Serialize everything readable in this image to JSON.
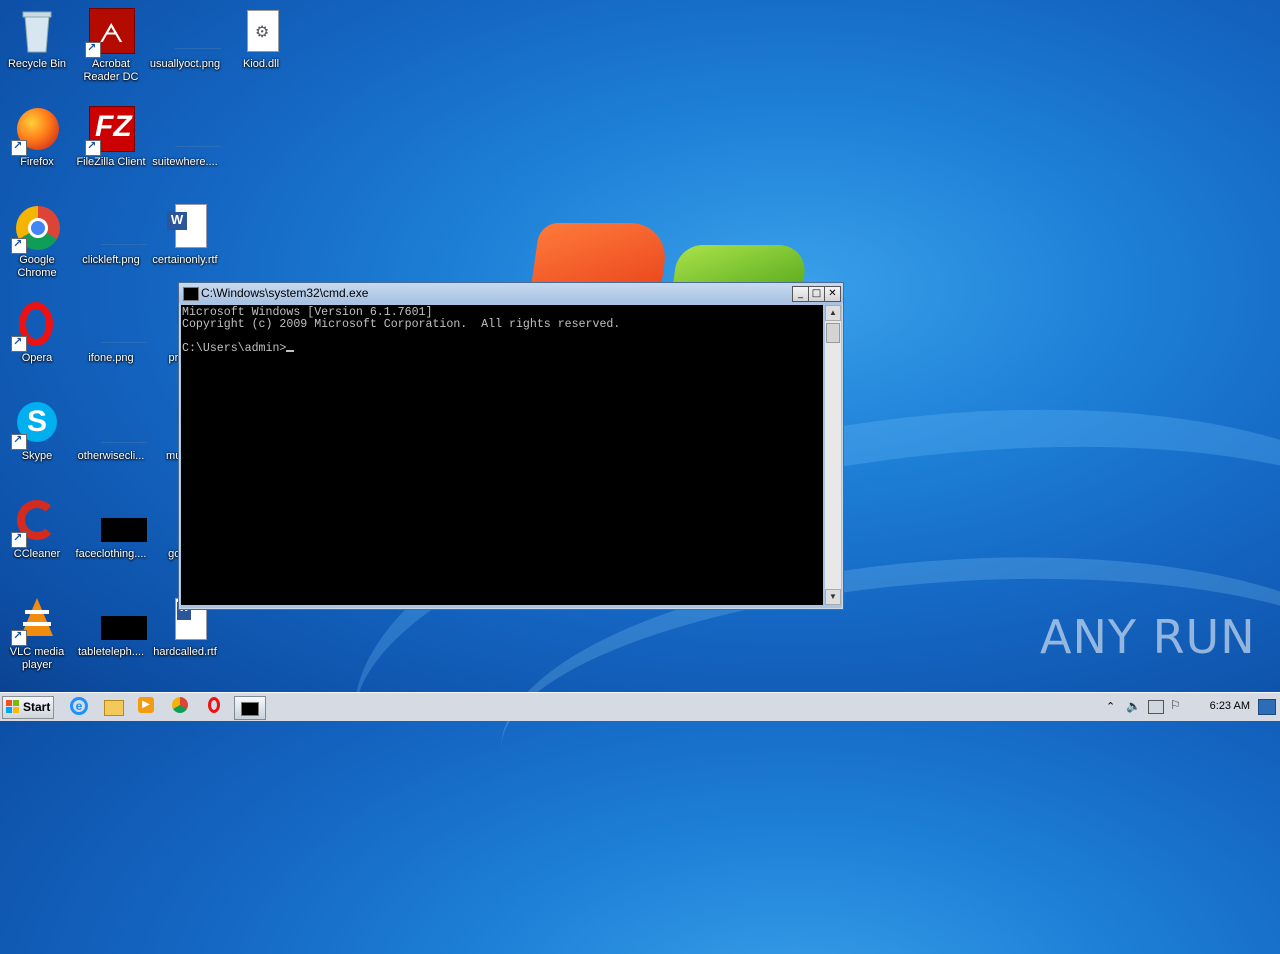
{
  "desktop": {
    "icons": [
      {
        "label": "Recycle Bin"
      },
      {
        "label": "Acrobat\nReader DC"
      },
      {
        "label": "usuallyoct.png"
      },
      {
        "label": "Kiod.dll"
      },
      {
        "label": "Firefox"
      },
      {
        "label": "FileZilla Client"
      },
      {
        "label": "suitewhere...."
      },
      {
        "label": "Google\nChrome"
      },
      {
        "label": "clickleft.png"
      },
      {
        "label": "certainonly.rtf"
      },
      {
        "label": "Opera"
      },
      {
        "label": "ifone.png"
      },
      {
        "label": "printi..."
      },
      {
        "label": "Skype"
      },
      {
        "label": "otherwisecli..."
      },
      {
        "label": "music..."
      },
      {
        "label": "CCleaner"
      },
      {
        "label": "faceclothing...."
      },
      {
        "label": "good..."
      },
      {
        "label": "VLC media\nplayer"
      },
      {
        "label": "tableteleph...."
      },
      {
        "label": "hardcalled.rtf"
      }
    ]
  },
  "cmd_window": {
    "title": "C:\\Windows\\system32\\cmd.exe",
    "lines": [
      "Microsoft Windows [Version 6.1.7601]",
      "Copyright (c) 2009 Microsoft Corporation.  All rights reserved.",
      "",
      "C:\\Users\\admin>"
    ],
    "controls": {
      "minimize": "_",
      "maximize": "□",
      "close": "✕"
    }
  },
  "taskbar": {
    "start_label": "Start",
    "clock": "6:23 AM",
    "pinned": [
      "internet-explorer",
      "explorer",
      "media-player",
      "chrome",
      "opera",
      "cmd"
    ]
  },
  "watermark": "ANY RUN"
}
